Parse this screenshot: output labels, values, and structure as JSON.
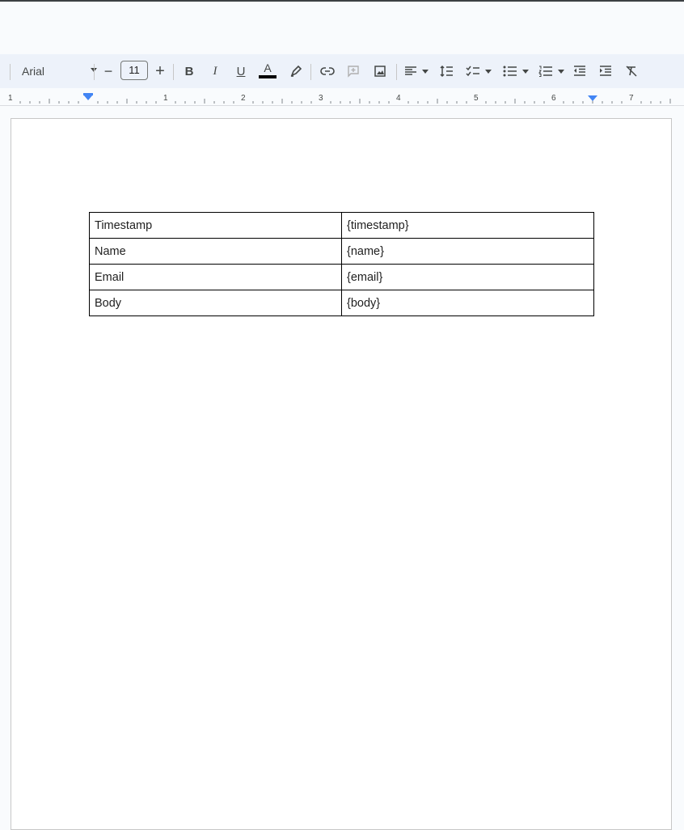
{
  "toolbar": {
    "font_family": "Arial",
    "font_size": "11",
    "decrease_label": "−",
    "increase_label": "+",
    "bold_label": "B",
    "italic_label": "I",
    "underline_label": "U",
    "text_color_label": "A",
    "text_color_value": "#000000",
    "icons": [
      "highlight-icon",
      "link-icon",
      "add-comment-icon",
      "insert-image-icon",
      "align-left-icon",
      "line-spacing-icon",
      "checklist-icon",
      "bulleted-list-icon",
      "numbered-list-icon",
      "decrease-indent-icon",
      "increase-indent-icon",
      "clear-formatting-icon"
    ]
  },
  "ruler": {
    "labels": [
      "1",
      "1",
      "2",
      "3",
      "4",
      "5",
      "6",
      "7"
    ]
  },
  "document": {
    "table": [
      {
        "label": "Timestamp",
        "value": "{timestamp}"
      },
      {
        "label": "Name",
        "value": "{name}"
      },
      {
        "label": "Email",
        "value": "{email}"
      },
      {
        "label": "Body",
        "value": "{body}"
      }
    ]
  },
  "colors": {
    "toolbar_bg": "#edf2fa",
    "accent_blue": "#4285f4"
  }
}
